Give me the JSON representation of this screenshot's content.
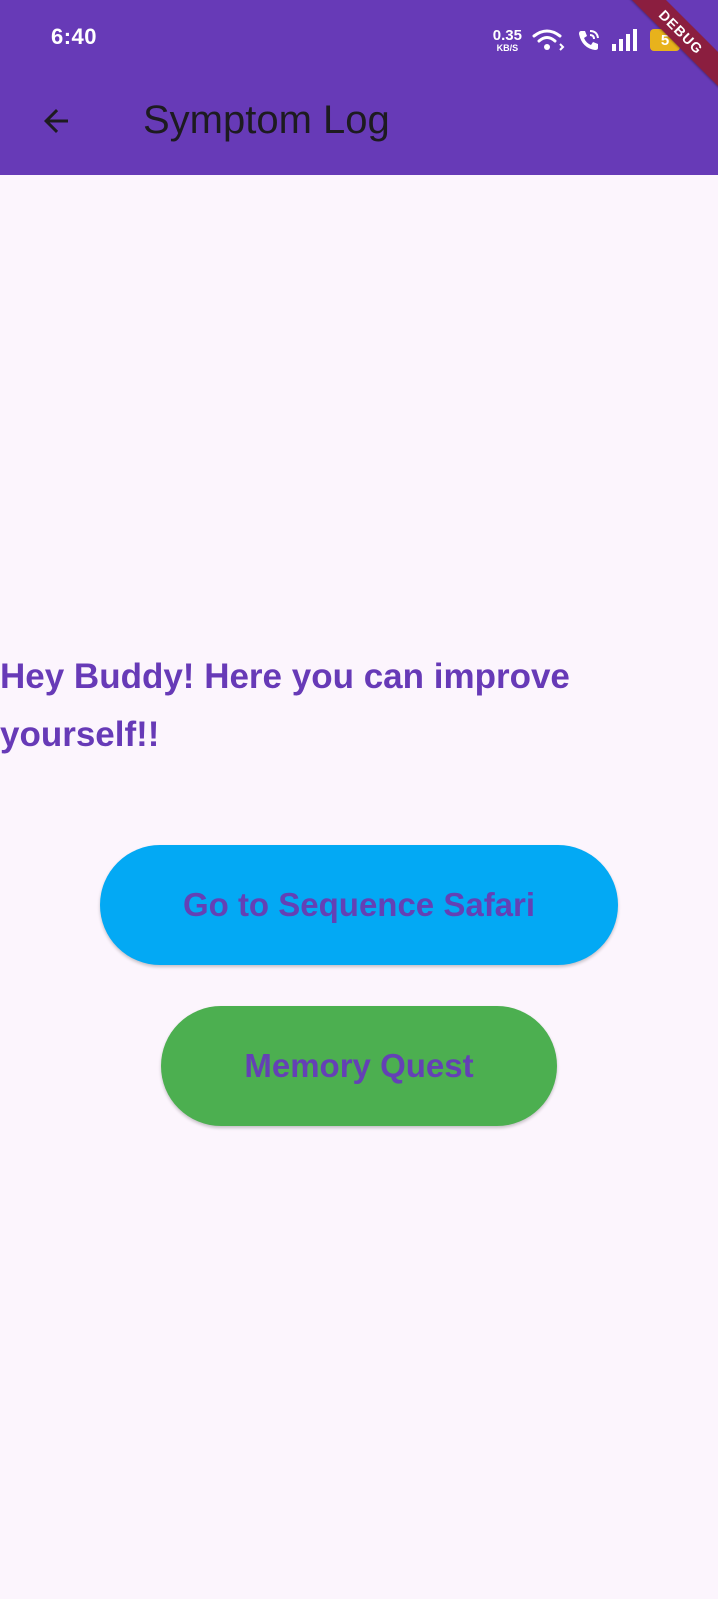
{
  "status_bar": {
    "time": "6:40",
    "net_speed_value": "0.35",
    "net_speed_unit": "KB/S",
    "battery": "5",
    "icons": [
      "wifi-icon",
      "wifi-call-icon",
      "signal-icon",
      "battery-icon"
    ]
  },
  "debug_banner": "DEBUG",
  "app_bar": {
    "back_icon": "arrow-back-icon",
    "title": "Symptom Log"
  },
  "main": {
    "headline": "Hey Buddy! Here you can improve yourself!!",
    "buttons": [
      {
        "label": "Go to Sequence Safari",
        "color": "#03A9F4"
      },
      {
        "label": "Memory Quest",
        "color": "#4CAF50"
      }
    ]
  },
  "colors": {
    "primary": "#673AB7",
    "background": "#FCF5FD",
    "button_text": "#6441B5",
    "title_text": "#1D1B20"
  }
}
